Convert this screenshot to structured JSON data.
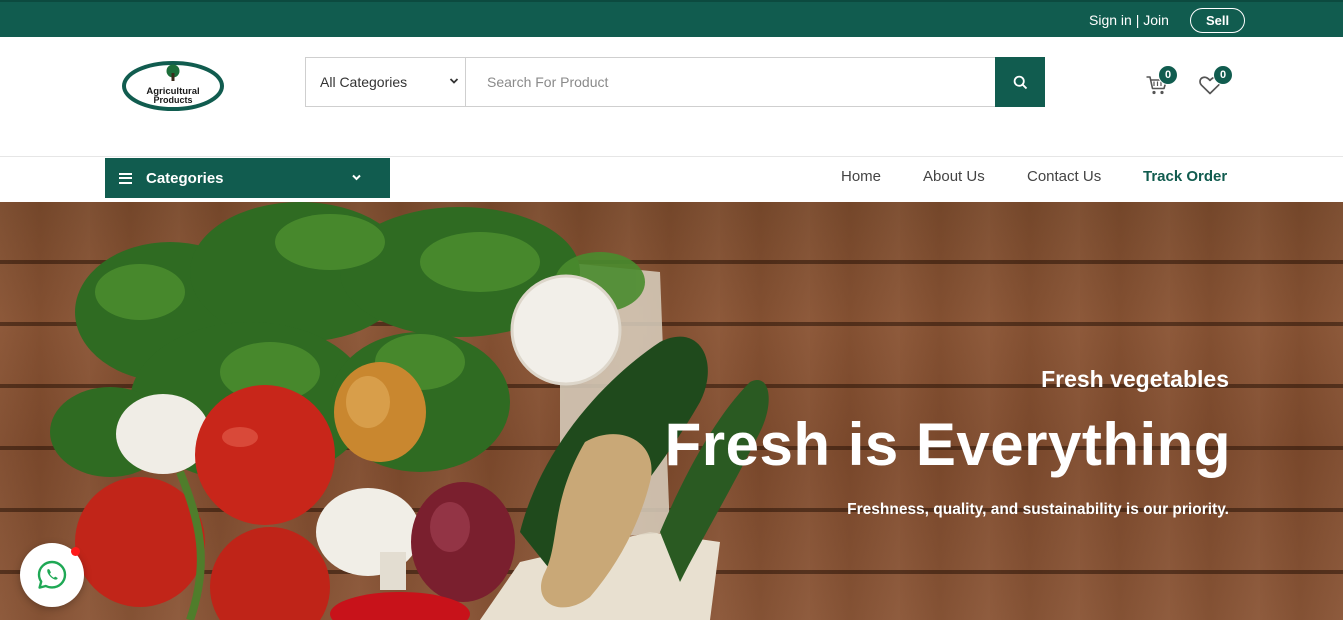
{
  "topbar": {
    "signin_label": "Sign in",
    "separator": "|",
    "join_label": "Join",
    "sell_label": "Sell"
  },
  "header": {
    "logo_text_line1": "Agricultural",
    "logo_text_line2": "Products",
    "category_select_value": "All Categories",
    "search_placeholder": "Search For Product",
    "cart_count": "0",
    "wishlist_count": "0"
  },
  "nav": {
    "categories_label": "Categories",
    "links": [
      "Home",
      "About Us",
      "Contact Us",
      "Track Order"
    ],
    "active_link": "Track Order"
  },
  "hero": {
    "subtitle": "Fresh vegetables",
    "title": "Fresh is Everything",
    "description": "Freshness, quality, and sustainability is our priority."
  },
  "colors": {
    "brand": "#115c4f",
    "wood": "#7f4b2d",
    "notification": "#ff1a1a"
  },
  "icons": [
    "search-icon",
    "cart-icon",
    "heart-icon",
    "hamburger-icon",
    "chevron-down-icon",
    "whatsapp-icon"
  ]
}
